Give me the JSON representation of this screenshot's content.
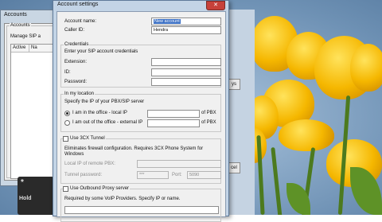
{
  "background_window": {
    "title": "Accounts",
    "group_title": "Accounts",
    "subtitle": "Manage SIP a",
    "columns": [
      "Active",
      "Na"
    ],
    "right_buttons": [
      "ys",
      "cel"
    ],
    "phone": {
      "star": "*",
      "hold_label": "Hold"
    }
  },
  "dialog": {
    "title": "Account settings",
    "close_glyph": "✕",
    "account_name_label": "Account name:",
    "account_name_value": "New account",
    "caller_id_label": "Caller ID:",
    "caller_id_value": "Hendra",
    "credentials": {
      "title": "Credentials",
      "hint": "Enter your SIP account credentials",
      "extension_label": "Extension:",
      "extension_value": "",
      "id_label": "ID:",
      "id_value": "",
      "password_label": "Password:",
      "password_value": ""
    },
    "location": {
      "title": "In my location",
      "hint": "Specify the IP of your PBX/SIP server",
      "office_option": "I am in the office - local IP",
      "out_option": "I am out of the office - external IP",
      "of_pbx": "of PBX",
      "selected": "office"
    },
    "tunnel": {
      "title": "Use 3CX Tunnel",
      "checked": false,
      "hint_line1": "Eliminates firewall configuration. Requires 3CX Phone System for",
      "hint_line2": "Windows",
      "local_ip_label": "Local IP of remote PBX:",
      "tunnel_password_label": "Tunnel password:",
      "tunnel_password_value": "***",
      "port_label": "Port:",
      "port_value": "5090"
    },
    "proxy": {
      "title": "Use Outbound Proxy server",
      "checked": false,
      "hint": "Required by some VoIP Providers. Specify IP or name."
    }
  }
}
